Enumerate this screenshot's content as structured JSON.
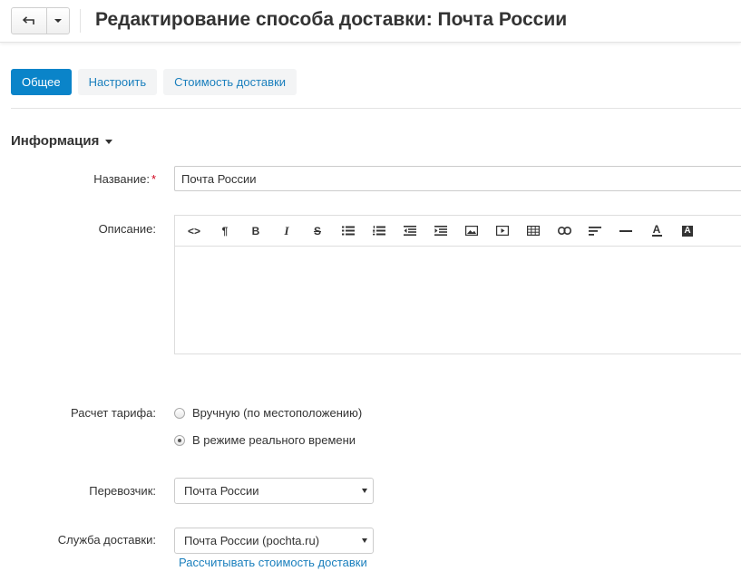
{
  "header": {
    "title": "Редактирование способа доставки: Почта России"
  },
  "tabs": [
    {
      "label": "Общее",
      "active": true
    },
    {
      "label": "Настроить",
      "active": false
    },
    {
      "label": "Стоимость доставки",
      "active": false
    }
  ],
  "section": {
    "title": "Информация"
  },
  "form": {
    "name_label": "Название:",
    "required_mark": "*",
    "name_value": "Почта России",
    "description_label": "Описание:",
    "tariff_label": "Расчет тарифа:",
    "tariff_options": [
      {
        "label": "Вручную (по местоположению)",
        "checked": false
      },
      {
        "label": "В режиме реального времени",
        "checked": true
      }
    ],
    "carrier_label": "Перевозчик:",
    "carrier_value": "Почта России",
    "service_label": "Служба доставки:",
    "service_value": "Почта России (pochta.ru)",
    "calc_link": "Рассчитывать стоимость доставки"
  },
  "editor_toolbar": [
    {
      "icon": "code-icon",
      "glyph": "<>"
    },
    {
      "icon": "paragraph-icon",
      "glyph": "¶"
    },
    {
      "icon": "bold-icon",
      "glyph": "B"
    },
    {
      "icon": "italic-icon",
      "glyph": "I"
    },
    {
      "icon": "strikethrough-icon",
      "glyph": "S"
    },
    {
      "icon": "unordered-list-icon",
      "glyph": ""
    },
    {
      "icon": "ordered-list-icon",
      "glyph": ""
    },
    {
      "icon": "outdent-icon",
      "glyph": ""
    },
    {
      "icon": "indent-icon",
      "glyph": ""
    },
    {
      "icon": "image-icon",
      "glyph": ""
    },
    {
      "icon": "video-icon",
      "glyph": ""
    },
    {
      "icon": "table-icon",
      "glyph": ""
    },
    {
      "icon": "link-icon",
      "glyph": ""
    },
    {
      "icon": "align-icon",
      "glyph": ""
    },
    {
      "icon": "horizontal-rule-icon",
      "glyph": ""
    },
    {
      "icon": "font-color-icon",
      "glyph": "A"
    },
    {
      "icon": "background-color-icon",
      "glyph": "A"
    }
  ],
  "colors": {
    "accent": "#0a84c9",
    "link": "#1a7fbd",
    "required": "#d0021b"
  }
}
